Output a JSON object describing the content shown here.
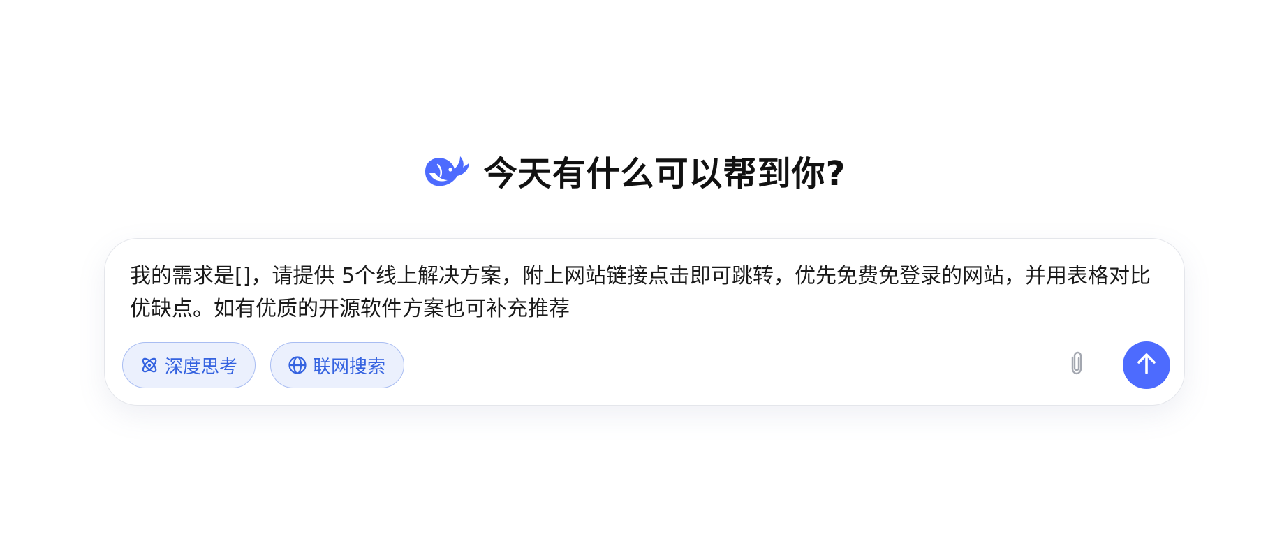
{
  "header": {
    "logo_icon": "deepseek-whale-icon",
    "title": "今天有什么可以帮到你?"
  },
  "composer": {
    "input_value": "我的需求是[]，请提供 5个线上解决方案，附上网站链接点击即可跳转，优先免费免登录的网站，并用表格对比优缺点。如有优质的开源软件方案也可补充推荐",
    "deep_think_label": "深度思考",
    "deep_think_icon": "atom-icon",
    "web_search_label": "联网搜索",
    "web_search_icon": "globe-icon",
    "attach_icon": "paperclip-icon",
    "send_icon": "arrow-up-icon"
  },
  "colors": {
    "brand": "#4d6bfe",
    "chip_text": "#3563e0",
    "chip_bg": "#ebf0fd",
    "chip_border": "#a9bdf2",
    "title": "#111111"
  }
}
